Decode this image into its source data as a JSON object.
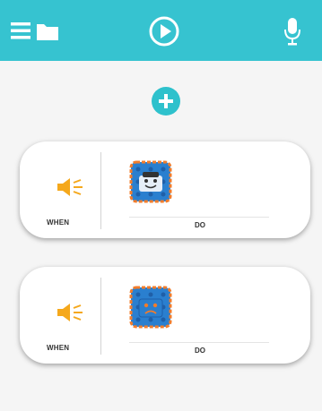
{
  "header": {
    "icons": [
      "menu-icon",
      "folder-icon",
      "play-icon",
      "microphone-icon"
    ]
  },
  "add_button": {
    "icon": "plus-icon"
  },
  "rules": [
    {
      "when_label": "WHEN",
      "do_label": "DO",
      "trigger_icon": "speaker-sound-icon",
      "action_icon": "robot-face-happy-icon"
    },
    {
      "when_label": "WHEN",
      "do_label": "DO",
      "trigger_icon": "speaker-sound-icon",
      "action_icon": "robot-face-sad-icon"
    }
  ],
  "colors": {
    "header_bg": "#36c3d0",
    "accent": "#2ec1cc",
    "speaker": "#f5a81c",
    "robot_bg": "#2a7fcf",
    "robot_border": "#f37c2a",
    "page_bg": "#f5f5f5"
  }
}
